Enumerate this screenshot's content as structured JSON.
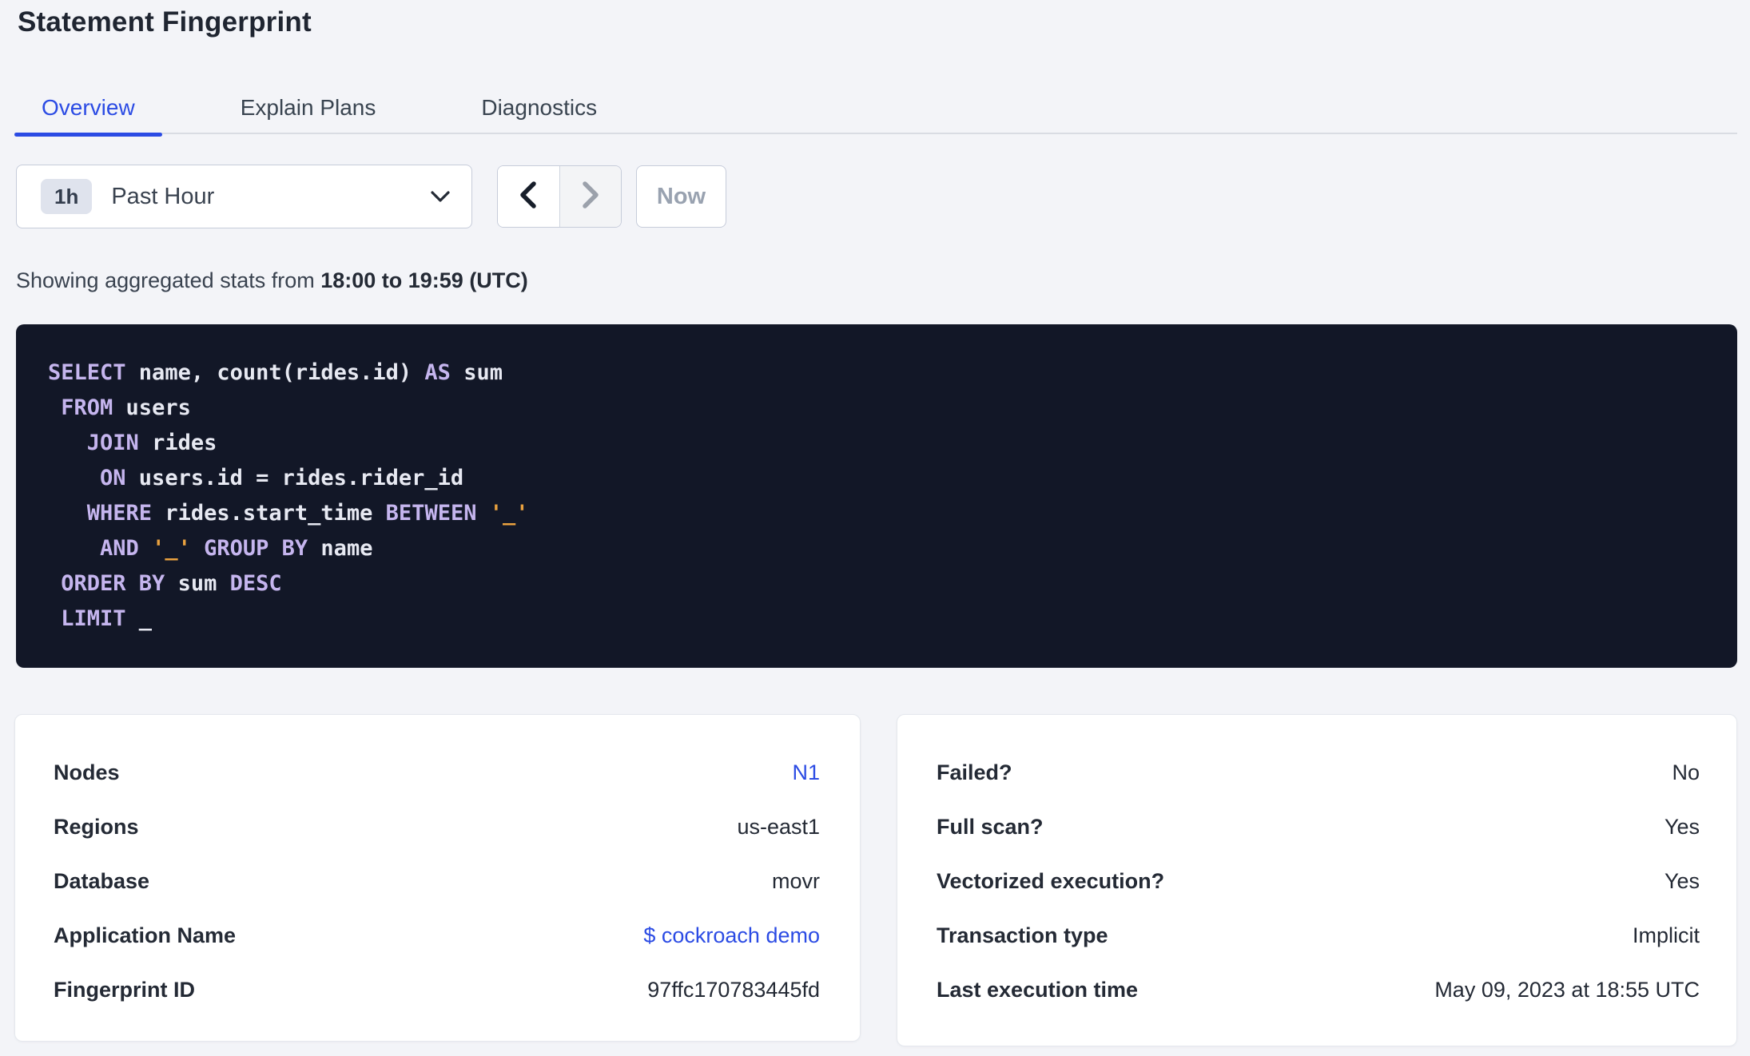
{
  "page": {
    "title": "Statement Fingerprint"
  },
  "tabs": [
    {
      "label": "Overview",
      "active": true
    },
    {
      "label": "Explain Plans",
      "active": false
    },
    {
      "label": "Diagnostics",
      "active": false
    }
  ],
  "time_controls": {
    "interval_badge": "1h",
    "interval_label": "Past Hour",
    "dropdown_icon": "chevron-down-icon",
    "prev_icon": "chevron-left-icon",
    "next_icon": "chevron-right-icon",
    "next_disabled": true,
    "now_label": "Now",
    "now_disabled": true
  },
  "stats_line": {
    "prefix": "Showing aggregated stats from ",
    "range_bold": "18:00 to 19:59 (UTC)"
  },
  "sql": {
    "lines": [
      [
        {
          "t": "SELECT",
          "c": "kw"
        },
        {
          "t": " name, count(rides.id) ",
          "c": "id"
        },
        {
          "t": "AS",
          "c": "kw"
        },
        {
          "t": " sum",
          "c": "id"
        }
      ],
      [
        {
          "t": " ",
          "c": "id"
        },
        {
          "t": "FROM",
          "c": "kw"
        },
        {
          "t": " users",
          "c": "id"
        }
      ],
      [
        {
          "t": "   ",
          "c": "id"
        },
        {
          "t": "JOIN",
          "c": "kw"
        },
        {
          "t": " rides",
          "c": "id"
        }
      ],
      [
        {
          "t": "    ",
          "c": "id"
        },
        {
          "t": "ON",
          "c": "kw"
        },
        {
          "t": " users.id = rides.rider_id",
          "c": "id"
        }
      ],
      [
        {
          "t": "   ",
          "c": "id"
        },
        {
          "t": "WHERE",
          "c": "kw"
        },
        {
          "t": " rides.start_time ",
          "c": "id"
        },
        {
          "t": "BETWEEN",
          "c": "kw"
        },
        {
          "t": " ",
          "c": "id"
        },
        {
          "t": "'_'",
          "c": "str"
        }
      ],
      [
        {
          "t": "    ",
          "c": "id"
        },
        {
          "t": "AND",
          "c": "kw"
        },
        {
          "t": " ",
          "c": "id"
        },
        {
          "t": "'_'",
          "c": "str"
        },
        {
          "t": " ",
          "c": "id"
        },
        {
          "t": "GROUP BY",
          "c": "kw"
        },
        {
          "t": " name",
          "c": "id"
        }
      ],
      [
        {
          "t": " ",
          "c": "id"
        },
        {
          "t": "ORDER BY",
          "c": "kw"
        },
        {
          "t": " sum ",
          "c": "id"
        },
        {
          "t": "DESC",
          "c": "kw"
        }
      ],
      [
        {
          "t": " ",
          "c": "id"
        },
        {
          "t": "LIMIT",
          "c": "kw"
        },
        {
          "t": " _",
          "c": "id"
        }
      ]
    ]
  },
  "cards": {
    "left": {
      "rows": [
        {
          "label": "Nodes",
          "value": "N1",
          "is_link": true
        },
        {
          "label": "Regions",
          "value": "us-east1",
          "is_link": false
        },
        {
          "label": "Database",
          "value": "movr",
          "is_link": false
        },
        {
          "label": "Application Name",
          "value": "$ cockroach demo",
          "is_link": true
        },
        {
          "label": "Fingerprint ID",
          "value": "97ffc170783445fd",
          "is_link": false
        }
      ]
    },
    "right": {
      "rows": [
        {
          "label": "Failed?",
          "value": "No",
          "is_link": false
        },
        {
          "label": "Full scan?",
          "value": "Yes",
          "is_link": false
        },
        {
          "label": "Vectorized execution?",
          "value": "Yes",
          "is_link": false
        },
        {
          "label": "Transaction type",
          "value": "Implicit",
          "is_link": false
        },
        {
          "label": "Last execution time",
          "value": "May 09, 2023 at 18:55 UTC",
          "is_link": false
        }
      ]
    }
  },
  "colors": {
    "accent_blue": "#2B4BE4",
    "page_background": "#F3F4F8",
    "code_background": "#121727",
    "code_keyword": "#C5B5EE",
    "code_identifier": "#E7E9F2",
    "code_string": "#EAA23F",
    "disabled_text": "#99A2B0"
  }
}
